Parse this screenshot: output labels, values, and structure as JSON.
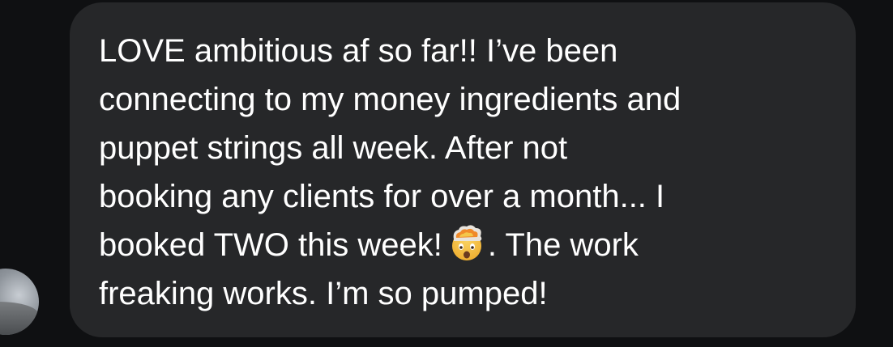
{
  "message": {
    "lines": [
      "LOVE ambitious af so far!! I’ve been",
      "connecting to my money ingredients and",
      "puppet strings all week. After not",
      "booking any clients for over a month... I",
      "booked TWO this week!",
      ". The work",
      "freaking works. I’m so pumped!"
    ],
    "emoji": "exploding-head-emoji"
  },
  "colors": {
    "background": "#0f1012",
    "bubble": "#262729",
    "text": "#ffffff"
  }
}
